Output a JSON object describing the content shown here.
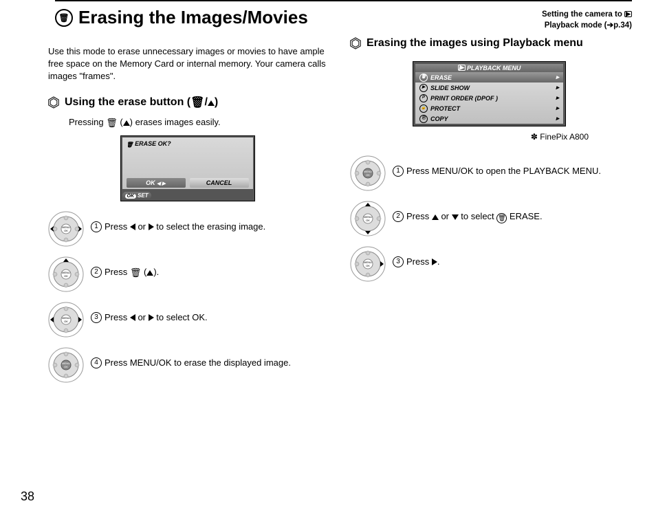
{
  "page_number": "38",
  "title": "Erasing the Images/Movies",
  "header_right": {
    "line1_a": "Setting the camera to ",
    "line2": "Playback mode (➔p.34)"
  },
  "intro": "Use this mode to erase unnecessary images or movies to have ample free space on the Memory Card or internal memory. Your camera calls images \"frames\".",
  "sec1": {
    "heading_prefix": "Using the erase button (",
    "heading_suffix": ")",
    "sub_a": "Pressing ",
    "sub_b": " (",
    "sub_c": ") erases images easily.",
    "lcd_title": "ERASE OK?",
    "lcd_ok": "OK",
    "lcd_cancel": "CANCEL",
    "lcd_foot_pill": "OK",
    "lcd_foot": "SET",
    "steps": [
      {
        "num": "1",
        "a": "Press ",
        "b": " or ",
        "c": " to select the erasing image."
      },
      {
        "num": "2",
        "a": "Press ",
        "b": " (",
        "c": ")."
      },
      {
        "num": "3",
        "a": "Press ",
        "b": " or ",
        "c": " to select OK."
      },
      {
        "num": "4",
        "a": "Press MENU/OK to erase the displayed image."
      }
    ]
  },
  "sec2": {
    "heading": "Erasing the images using Playback menu",
    "menu_head": "PLAYBACK MENU",
    "menu_items": [
      {
        "label": "ERASE",
        "sel": true
      },
      {
        "label": "SLIDE SHOW",
        "sel": false
      },
      {
        "label": "PRINT ORDER (DPOF )",
        "sel": false
      },
      {
        "label": "PROTECT",
        "sel": false
      },
      {
        "label": "COPY",
        "sel": false
      }
    ],
    "note_prefix": "✽ ",
    "note": "FinePix A800",
    "steps": [
      {
        "num": "1",
        "text": "Press MENU/OK to open the PLAYBACK MENU."
      },
      {
        "num": "2",
        "a": "Press ",
        "b": " or ",
        "c": " to select ",
        "d": " ERASE."
      },
      {
        "num": "3",
        "a": "Press ",
        "b": "."
      }
    ]
  }
}
